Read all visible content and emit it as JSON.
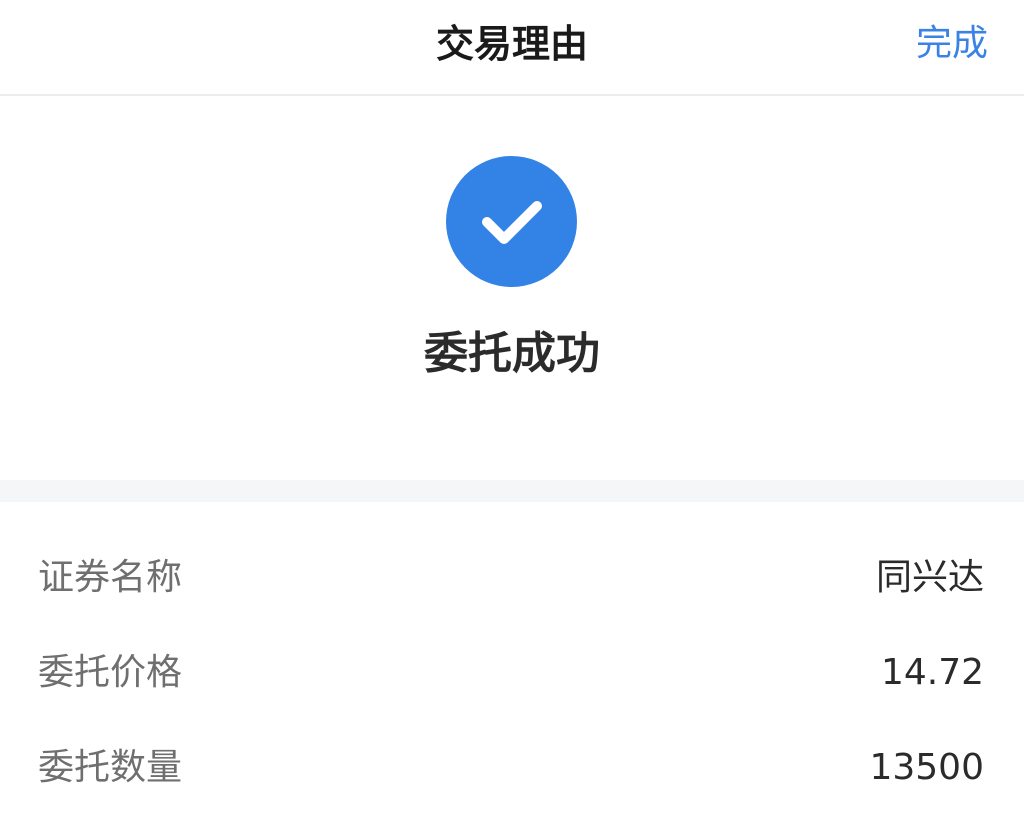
{
  "header": {
    "title": "交易理由",
    "done_label": "完成"
  },
  "result": {
    "icon": "checkmark-icon",
    "accent_color": "#3383e6",
    "message": "委托成功"
  },
  "details": [
    {
      "label": "证券名称",
      "value": "同兴达"
    },
    {
      "label": "委托价格",
      "value": "14.72"
    },
    {
      "label": "委托数量",
      "value": "13500"
    }
  ]
}
